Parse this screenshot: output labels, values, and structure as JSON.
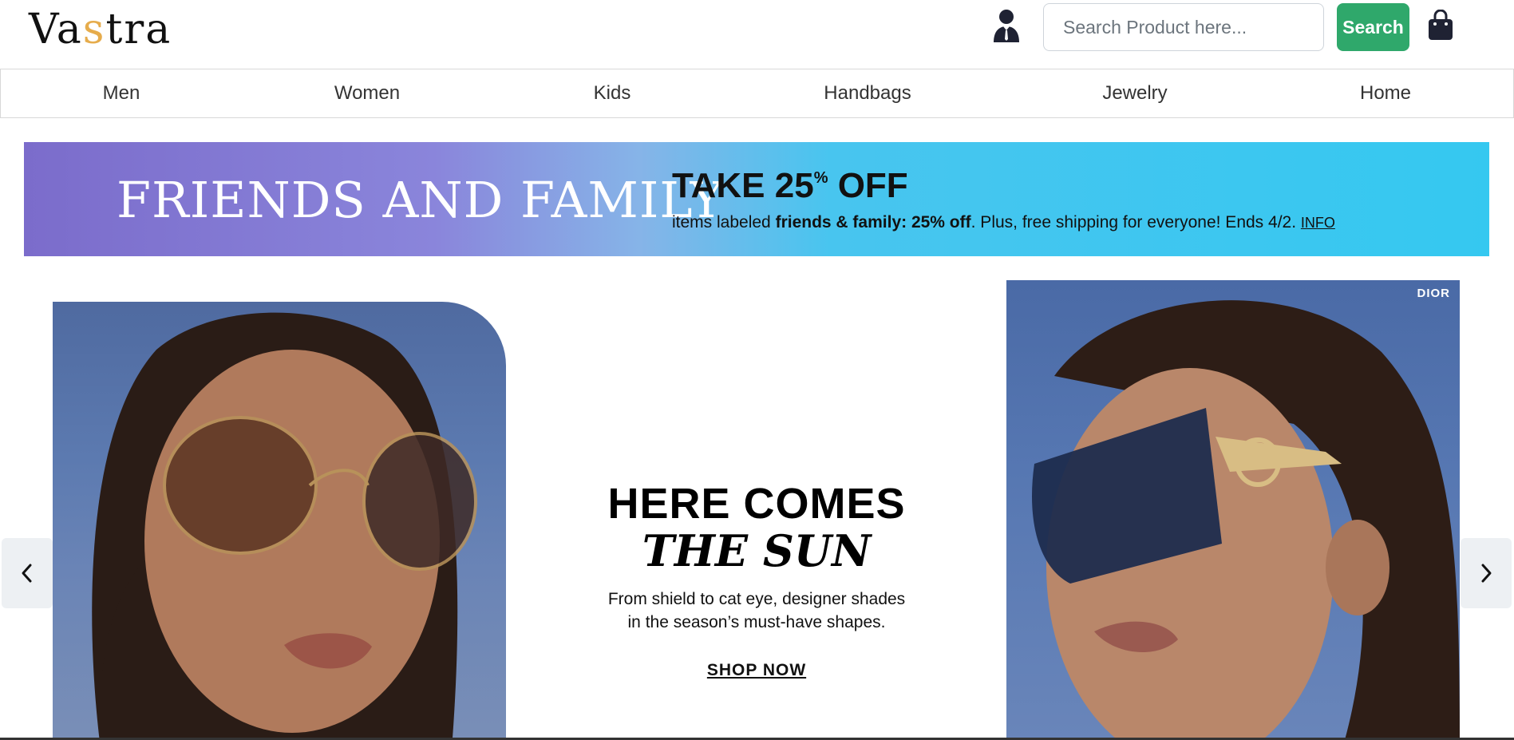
{
  "header": {
    "logo": {
      "part1": "Va",
      "accent": "s",
      "part2": "tra"
    },
    "account_icon": "user-icon",
    "search": {
      "placeholder": "Search Product here...",
      "value": "",
      "button_label": "Search"
    },
    "cart_icon": "shopping-bag-icon"
  },
  "nav": {
    "items": [
      {
        "label": "Men"
      },
      {
        "label": "Women"
      },
      {
        "label": "Kids"
      },
      {
        "label": "Handbags"
      },
      {
        "label": "Jewelry"
      },
      {
        "label": "Home"
      }
    ]
  },
  "promo": {
    "title": "FRIENDS AND FAMILY",
    "headline": "TAKE 25",
    "headline_sup": "%",
    "headline_tail": " OFF",
    "sub_prefix": "items labeled ",
    "sub_bold": "friends & family: 25% off",
    "sub_suffix": ". Plus, free shipping for everyone! Ends 4/2. ",
    "info_link": "INFO"
  },
  "hero": {
    "brand_tag": "DIOR",
    "title_line1": "HERE COMES",
    "title_line2": "THE SUN",
    "desc_line1": "From shield to cat eye, designer shades",
    "desc_line2": "in the season’s must-have shapes.",
    "cta": "SHOP NOW",
    "prev_icon": "chevron-left-icon",
    "next_icon": "chevron-right-icon"
  },
  "colors": {
    "logo_accent": "#e6ac4c",
    "search_button": "#2fa86b",
    "promo_gradient_start": "#7b6ccb",
    "promo_gradient_end": "#35c8f0"
  }
}
